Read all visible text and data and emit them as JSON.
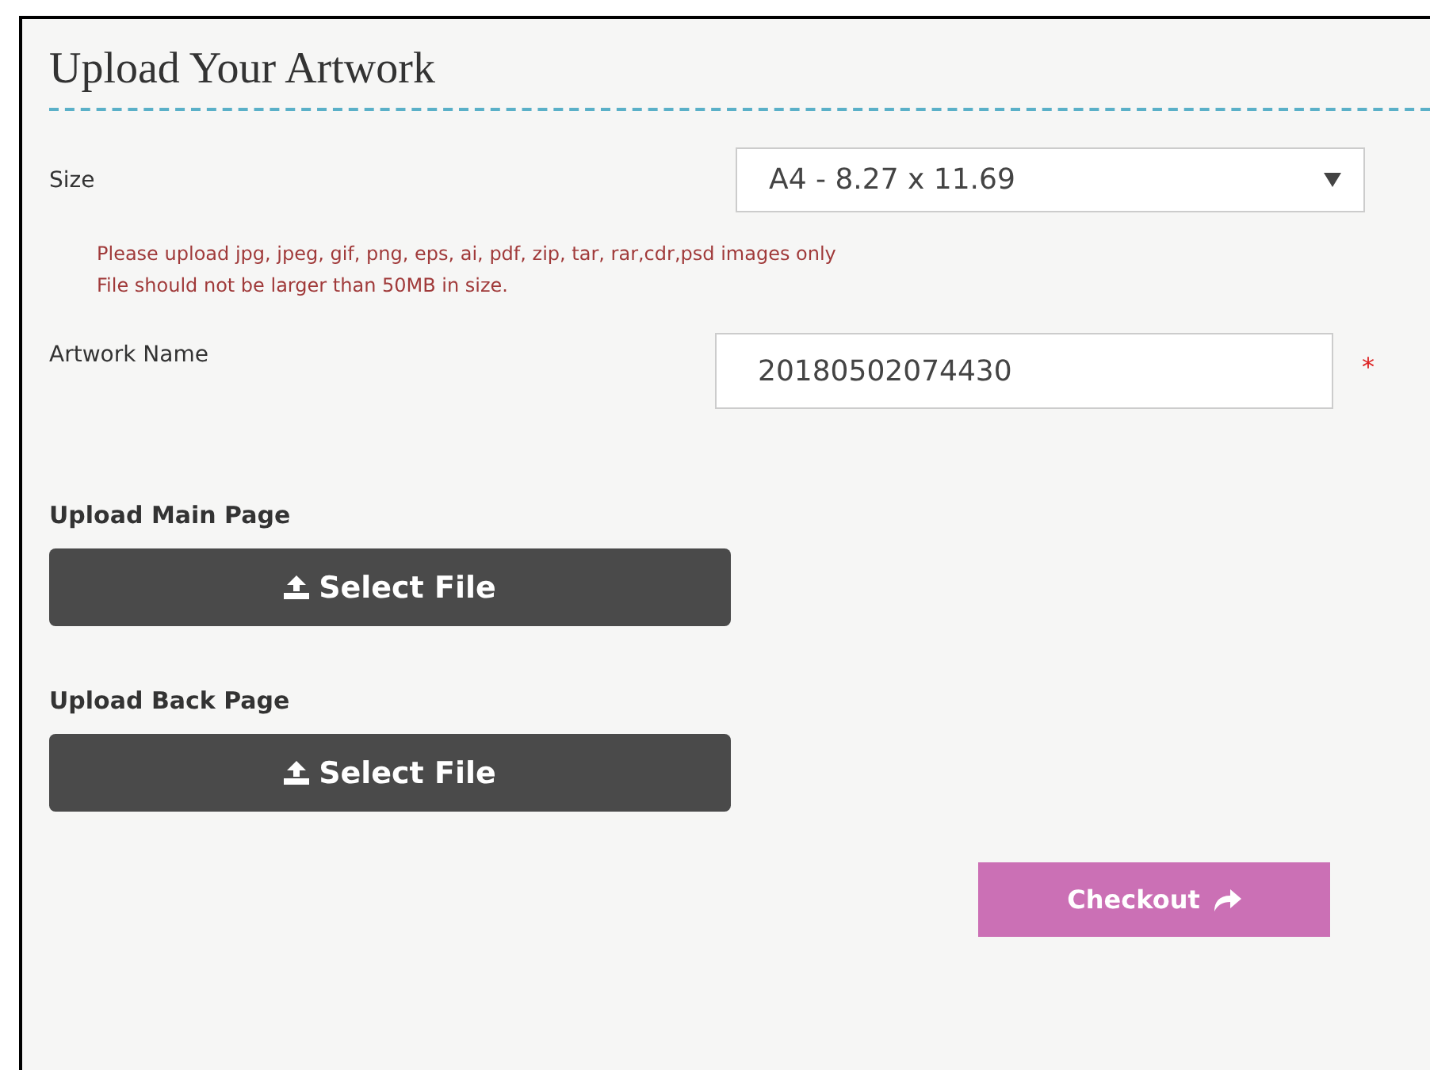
{
  "title": "Upload Your Artwork",
  "size": {
    "label": "Size",
    "value": "A4 - 8.27 x 11.69"
  },
  "notes": [
    "Please upload jpg, jpeg, gif, png, eps, ai, pdf, zip, tar, rar,cdr,psd images only",
    "File should not be larger than 50MB in size."
  ],
  "artwork_name": {
    "label": "Artwork Name",
    "value": "20180502074430",
    "required_mark": "*"
  },
  "uploads": [
    {
      "label": "Upload Main Page",
      "button": "Select File"
    },
    {
      "label": "Upload Back Page",
      "button": "Select File"
    }
  ],
  "checkout": "Checkout"
}
